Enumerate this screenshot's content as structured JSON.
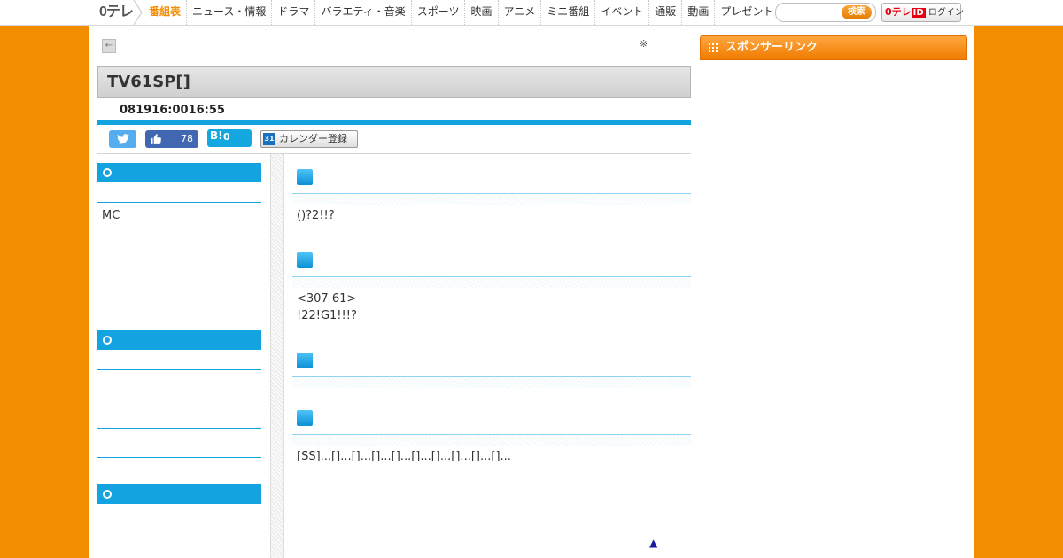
{
  "header": {
    "logo": "0テレ",
    "nav": [
      "番組表",
      "ニュース・情報",
      "ドラマ",
      "バラエティ・音楽",
      "スポーツ",
      "映画",
      "アニメ",
      "ミニ番組",
      "イベント",
      "通販",
      "動画",
      "プレゼント"
    ],
    "search_placeholder": "",
    "search_button": "検索",
    "login_logo": "0テレ",
    "login_id": "ID",
    "login_label": "ログイン"
  },
  "page": {
    "note_mark": "※",
    "title": "TV61SP[]",
    "date": "081916:0016:55"
  },
  "share": {
    "like_count": "78",
    "hatena_label": "B!",
    "hatena_count": "0",
    "calendar_label": "カレンダー登録",
    "calendar_icon_text": "31"
  },
  "left": {
    "mc_text": "MC"
  },
  "main": {
    "section1_text": "()?2!!?",
    "section2_line1": "<307 61>",
    "section2_line2": "!22!G1!!!?",
    "section4_text": "[SS]...[]...[]...[]...[]...[]...[]...[]...[]...[]...",
    "top_arrow": "▲"
  },
  "sponsor": {
    "label": "スポンサーリンク"
  },
  "colors": {
    "brand_orange": "#f28c00",
    "accent_blue": "#12a3e0"
  }
}
